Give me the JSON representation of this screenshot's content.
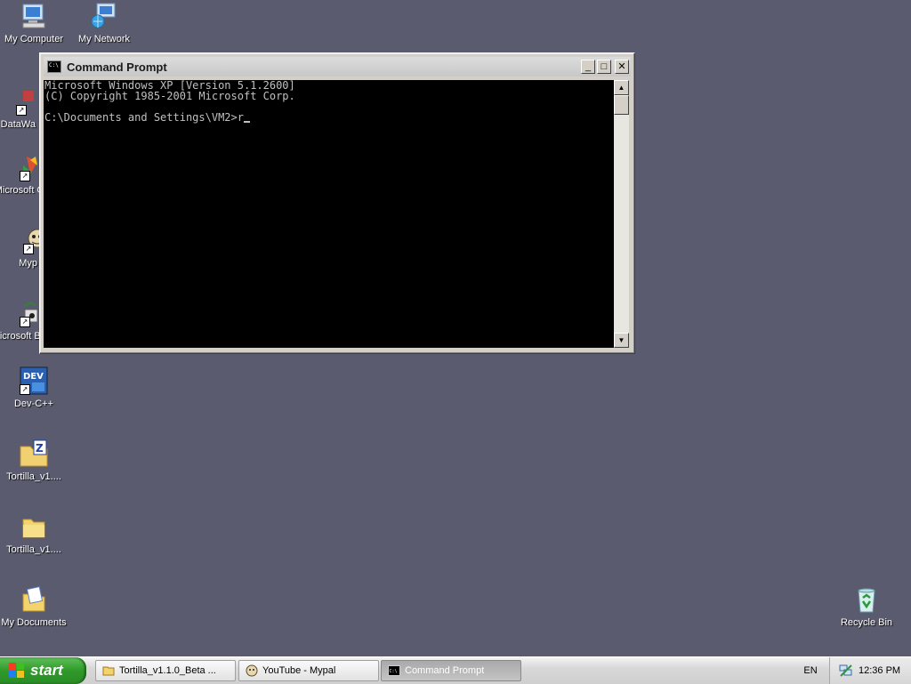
{
  "desktop": {
    "icons": [
      {
        "name": "my-computer",
        "label": "My Computer"
      },
      {
        "name": "my-network-places",
        "label": "My Network Places"
      },
      {
        "name": "datawarehouse",
        "label": "DataWa"
      },
      {
        "name": "microsoft-cpp",
        "label": "Microsoft C++"
      },
      {
        "name": "mypal",
        "label": "Myp"
      },
      {
        "name": "microsoft-basic",
        "label": "Microsoft Basic"
      },
      {
        "name": "dev-cpp",
        "label": "Dev-C++"
      },
      {
        "name": "tortilla-zip",
        "label": "Tortilla_v1...."
      },
      {
        "name": "tortilla-folder",
        "label": "Tortilla_v1...."
      },
      {
        "name": "my-documents",
        "label": "My Documents"
      },
      {
        "name": "recycle-bin",
        "label": "Recycle Bin"
      }
    ]
  },
  "window": {
    "title": "Command Prompt",
    "minimize": "_",
    "maximize": "□",
    "close": "✕",
    "lines": [
      "Microsoft Windows XP [Version 5.1.2600]",
      "(C) Copyright 1985-2001 Microsoft Corp.",
      "",
      "C:\\Documents and Settings\\VM2>r"
    ]
  },
  "taskbar": {
    "start_label": "start",
    "tasks": [
      {
        "label": "Tortilla_v1.1.0_Beta ...",
        "icon": "folder-icon"
      },
      {
        "label": "YouTube - Mypal",
        "icon": "browser-icon"
      },
      {
        "label": "Command Prompt",
        "icon": "cmd-icon"
      }
    ],
    "language": "EN",
    "clock": "12:36 PM"
  },
  "colors": {
    "desktop_bg": "#5a5b6e",
    "start_green": "#2f9a2a",
    "console_bg": "#000000",
    "console_fg": "#c0c0c0"
  }
}
